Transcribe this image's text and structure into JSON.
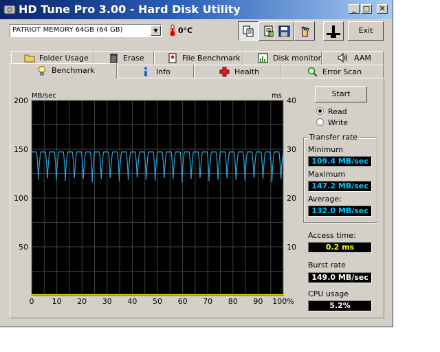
{
  "window": {
    "title": "HD Tune Pro 3.00 - Hard Disk Utility",
    "min_label": "_",
    "max_label": "□",
    "close_label": "✕"
  },
  "toolbar": {
    "drive_value": "PATRIOT MEMORY 64GB (64 GB)",
    "temperature": "0°C",
    "exit_label": "Exit",
    "buttons": [
      "copy-text-icon",
      "copy-screenshot-icon",
      "save-icon",
      "options-icon",
      "disk-icon"
    ]
  },
  "tabs_top": [
    "Folder Usage",
    "Erase",
    "File Benchmark",
    "Disk monitor",
    "AAM"
  ],
  "tabs_bottom": [
    "Benchmark",
    "Info",
    "Health",
    "Error Scan"
  ],
  "controls": {
    "start_label": "Start",
    "read_label": "Read",
    "write_label": "Write",
    "selected": "read"
  },
  "transfer": {
    "group_title": "Transfer rate",
    "minimum_label": "Minimum",
    "minimum_value": "109.4 MB/sec",
    "maximum_label": "Maximum",
    "maximum_value": "147.2 MB/sec",
    "average_label": "Average:",
    "average_value": "132.0 MB/sec"
  },
  "access": {
    "label": "Access time:",
    "value": "0.2 ms"
  },
  "burst": {
    "label": "Burst rate",
    "value": "149.0 MB/sec"
  },
  "cpu": {
    "label": "CPU usage",
    "value": "5.2%"
  },
  "colors": {
    "plot_bg": "#000000",
    "read_line": "#29a8e0",
    "access_line": "#e8e000",
    "value_blue": "#00c8ff",
    "value_yellow": "#ffff00"
  },
  "chart_data": {
    "type": "line",
    "y_left_unit": "MB/sec",
    "y_right_unit": "ms",
    "y_left_ticks": [
      "200",
      "150",
      "100",
      "50"
    ],
    "y_right_ticks": [
      "40",
      "30",
      "20",
      "10"
    ],
    "x_ticks": [
      "0",
      "10",
      "20",
      "30",
      "40",
      "50",
      "60",
      "70",
      "80",
      "90",
      "100%"
    ],
    "ylim_left": [
      0,
      200
    ],
    "ylim_right": [
      0,
      40
    ],
    "xlim": [
      0,
      100
    ],
    "grid": true,
    "series": [
      {
        "axis": "left",
        "color": "#29a8e0",
        "periodic": {
          "period": 3.57,
          "min": 109.4,
          "max": 147.2
        }
      },
      {
        "axis": "right",
        "color": "#e8e000",
        "values_constant": 0.2
      }
    ]
  }
}
